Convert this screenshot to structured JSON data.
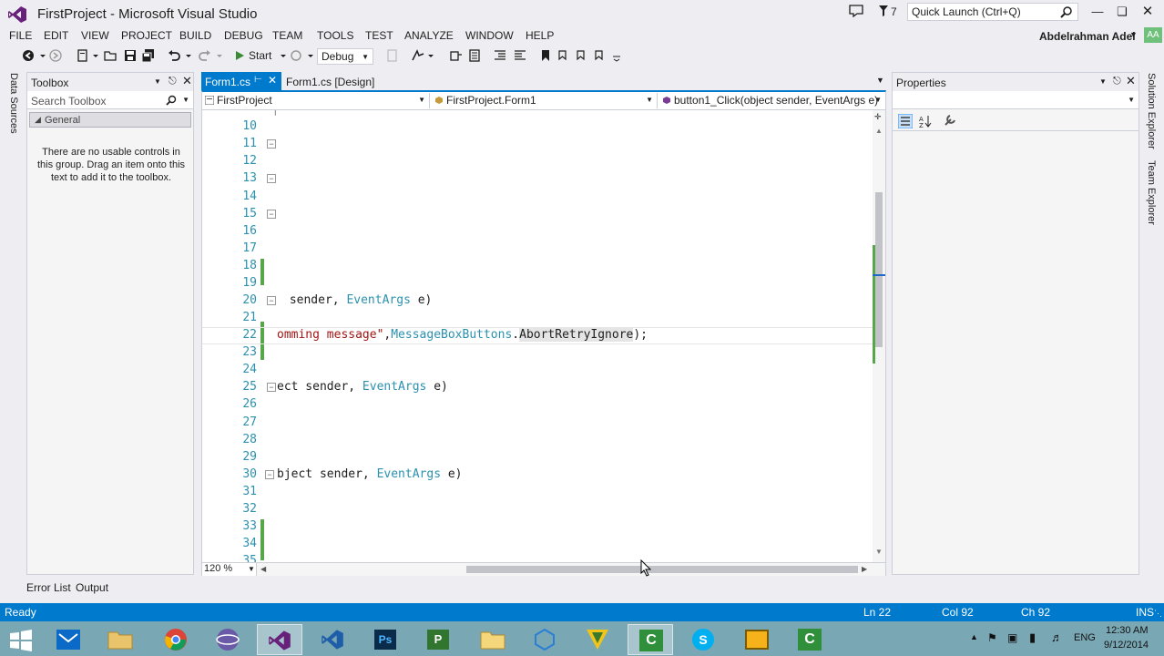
{
  "window": {
    "title": "FirstProject - Microsoft Visual Studio",
    "notification_count": "7",
    "quick_launch_placeholder": "Quick Launch (Ctrl+Q)",
    "user_name": "Abdelrahman Adel",
    "user_initials": "AA"
  },
  "menu": [
    "FILE",
    "EDIT",
    "VIEW",
    "PROJECT",
    "BUILD",
    "DEBUG",
    "TEAM",
    "TOOLS",
    "TEST",
    "ANALYZE",
    "WINDOW",
    "HELP"
  ],
  "toolbar": {
    "start_label": "Start",
    "configuration": "Debug"
  },
  "left_strip": {
    "data_sources_label": "Data Sources"
  },
  "toolbox": {
    "title": "Toolbox",
    "search_placeholder": "Search Toolbox",
    "group_name": "General",
    "empty_message": "There are no usable controls in this group. Drag an item onto this text to add it to the toolbox."
  },
  "editor": {
    "tabs": [
      {
        "label": "Form1.cs",
        "active": true
      },
      {
        "label": "Form1.cs [Design]",
        "active": false
      }
    ],
    "nav": {
      "project": "FirstProject",
      "class": "FirstProject.Form1",
      "member": "button1_Click(object sender, EventArgs e)"
    },
    "zoom": "120 %",
    "lines": [
      {
        "num": "10",
        "code": ""
      },
      {
        "num": "11",
        "code": ""
      },
      {
        "num": "12",
        "code": ""
      },
      {
        "num": "13",
        "code": ""
      },
      {
        "num": "14",
        "code": ""
      },
      {
        "num": "15",
        "code": ""
      },
      {
        "num": "16",
        "code": ""
      },
      {
        "num": "17",
        "code": ""
      },
      {
        "num": "18",
        "code": ""
      },
      {
        "num": "19",
        "code": ""
      },
      {
        "num": "20",
        "code_a": " sender, ",
        "code_type": "EventArgs",
        "code_b": " e)"
      },
      {
        "num": "21",
        "code": ""
      },
      {
        "num": "22",
        "code_str": "omming message\"",
        "code_mid": ",",
        "code_type": "MessageBoxButtons",
        "code_dot": ".",
        "code_hl": "AbortRetryIgnore",
        "code_end": ");"
      },
      {
        "num": "23",
        "code": ""
      },
      {
        "num": "24",
        "code": ""
      },
      {
        "num": "25",
        "code_a": "ect sender, ",
        "code_type": "EventArgs",
        "code_b": " e)"
      },
      {
        "num": "26",
        "code": ""
      },
      {
        "num": "27",
        "code": ""
      },
      {
        "num": "28",
        "code": ""
      },
      {
        "num": "29",
        "code": ""
      },
      {
        "num": "30",
        "code_a": "bject sender, ",
        "code_type": "EventArgs",
        "code_b": " e)"
      },
      {
        "num": "31",
        "code": ""
      },
      {
        "num": "32",
        "code": ""
      },
      {
        "num": "33",
        "code": ""
      },
      {
        "num": "34",
        "code": ""
      },
      {
        "num": "35",
        "code": ""
      }
    ]
  },
  "properties": {
    "title": "Properties"
  },
  "right_strip": {
    "solution_explorer": "Solution Explorer",
    "team_explorer": "Team Explorer"
  },
  "bottom_tabs": [
    "Error List",
    "Output"
  ],
  "status": {
    "state": "Ready",
    "line": "Ln 22",
    "col": "Col 92",
    "ch": "Ch 92",
    "mode": "INS"
  },
  "taskbar": {
    "language": "ENG",
    "time": "12:30 AM",
    "date": "9/12/2014",
    "apps": [
      "start-icon",
      "mail-icon",
      "file-explorer-icon",
      "chrome-icon",
      "browser-icon",
      "visual-studio-icon",
      "visual-studio-icon-2",
      "photoshop-icon",
      "project-icon",
      "folder-icon",
      "network-icon",
      "vectorworks-icon",
      "camtasia-icon",
      "skype-icon",
      "media-icon",
      "camtasia-recorder-icon"
    ]
  }
}
